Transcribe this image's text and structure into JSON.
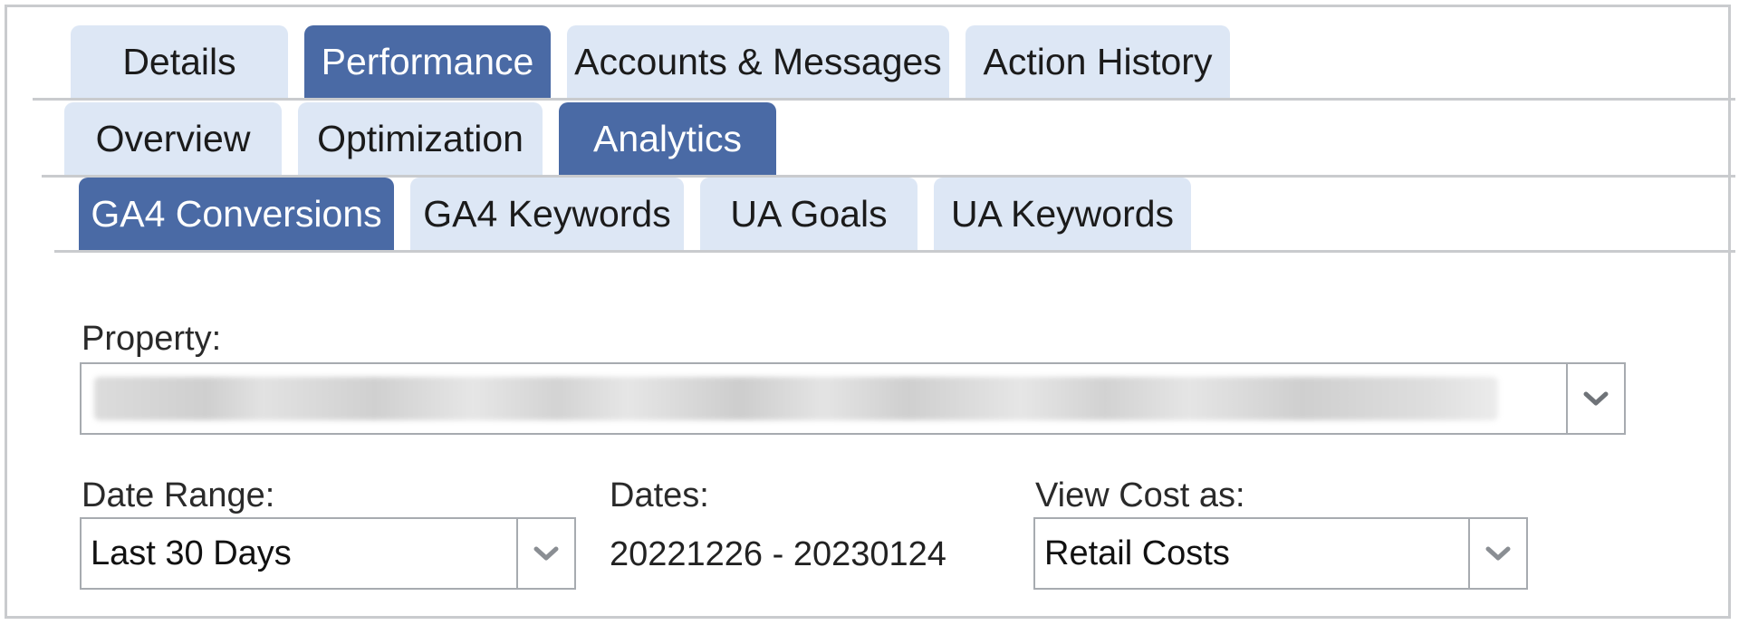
{
  "tabs_level1": {
    "items": [
      {
        "label": "Details",
        "active": false
      },
      {
        "label": "Performance",
        "active": true
      },
      {
        "label": "Accounts & Messages",
        "active": false
      },
      {
        "label": "Action History",
        "active": false
      }
    ]
  },
  "tabs_level2": {
    "items": [
      {
        "label": "Overview",
        "active": false
      },
      {
        "label": "Optimization",
        "active": false
      },
      {
        "label": "Analytics",
        "active": true
      }
    ]
  },
  "tabs_level3": {
    "items": [
      {
        "label": "GA4 Conversions",
        "active": true
      },
      {
        "label": "GA4 Keywords",
        "active": false
      },
      {
        "label": "UA Goals",
        "active": false
      },
      {
        "label": "UA Keywords",
        "active": false
      }
    ]
  },
  "form": {
    "property_label": "Property:",
    "property_value_redacted": true,
    "date_range_label": "Date Range:",
    "date_range_value": "Last 30 Days",
    "dates_label": "Dates:",
    "dates_value": "20221226 - 20230124",
    "view_cost_label": "View Cost as:",
    "view_cost_value": "Retail Costs"
  },
  "icons": {
    "dropdown": "chevron-down-icon"
  },
  "colors": {
    "active_tab": "#4a6aa5",
    "inactive_tab": "#dde7f5",
    "border": "#a7abb0"
  }
}
